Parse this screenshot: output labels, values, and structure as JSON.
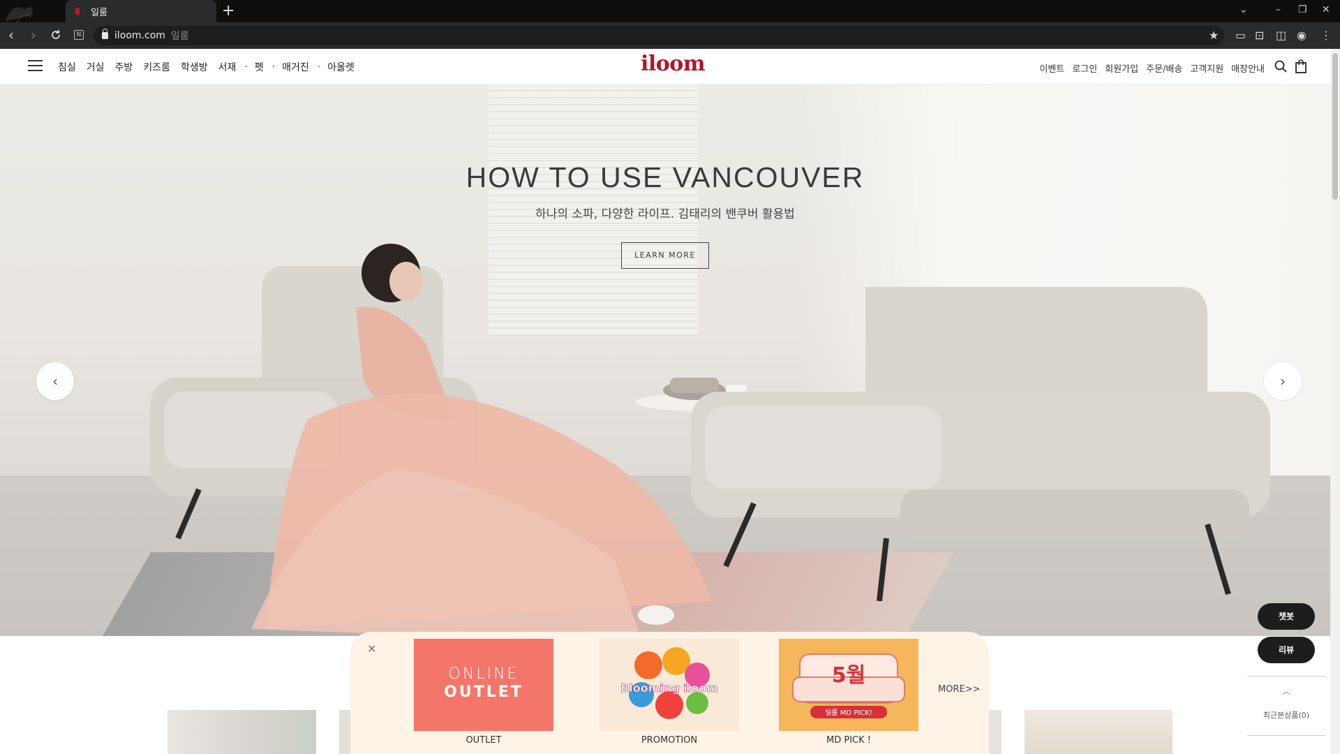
{
  "browser": {
    "tab_title": "일룸",
    "new_tab": "+",
    "url_host": "iloom.com",
    "url_title": "일룸"
  },
  "header": {
    "logo": "iloom",
    "main_nav": [
      "침실",
      "거실",
      "주방",
      "키즈룸",
      "학생방",
      "서재",
      "펫",
      "매거진",
      "아울렛"
    ],
    "util_nav": [
      "이벤트",
      "로그인",
      "회원가입",
      "주문/배송",
      "고객지원",
      "매장안내"
    ]
  },
  "hero": {
    "title": "HOW TO USE VANCOUVER",
    "subtitle": "하나의 소파, 다양한 라이프. 김태리의 밴쿠버 활용법",
    "button": "LEARN MORE",
    "prev": "‹",
    "next": "›"
  },
  "promo": {
    "close": "×",
    "cards": [
      {
        "label": "OUTLET",
        "line1": "ONLINE",
        "line2": "OUTLET"
      },
      {
        "label": "PROMOTION",
        "text": "Blooming iloom"
      },
      {
        "label": "MD PICK !",
        "big": "5월",
        "tag": "일룸 MD PICK!"
      }
    ],
    "more": "MORE>>"
  },
  "floating": {
    "chatbot": "챗봇",
    "review": "리뷰",
    "top_chevron": "︿",
    "recent": "최근본상품(0)"
  },
  "colors": {
    "brand": "#b4142c",
    "outlet_card": "#f4766a",
    "md_card": "#f6b65b",
    "promo_bg": "#fdf3e6"
  }
}
